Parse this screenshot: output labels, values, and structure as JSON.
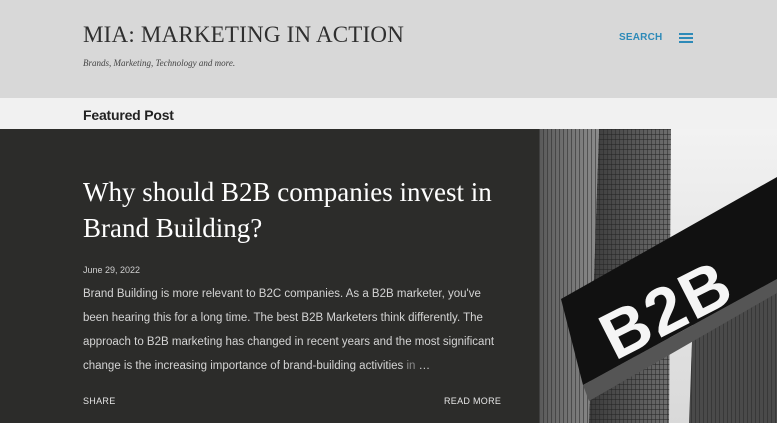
{
  "header": {
    "site_title": "MIA: MARKETING IN ACTION",
    "tagline": "Brands, Marketing, Technology and more.",
    "search_label": "SEARCH",
    "menu_icon": "hamburger-menu-icon"
  },
  "featured": {
    "section_label": "Featured Post",
    "post": {
      "title": "Why should B2B companies invest in Brand Building?",
      "date": "June 29, 2022",
      "snippet": "Brand Building is more relevant to B2C companies. As a B2B marketer, you've been hearing this for a long time. The best B2B Marketers think differently. The approach to B2B marketing has changed in recent years and the most significant change is the increasing importance of brand-building activities",
      "snippet_faded": " in",
      "ellipsis": " …",
      "share_label": "SHARE",
      "read_more_label": "READ MORE",
      "image_text": "B2B"
    }
  },
  "colors": {
    "accent": "#2d8ab8",
    "header_bg": "#d8d8d8",
    "post_bg": "#2c2c2a"
  }
}
